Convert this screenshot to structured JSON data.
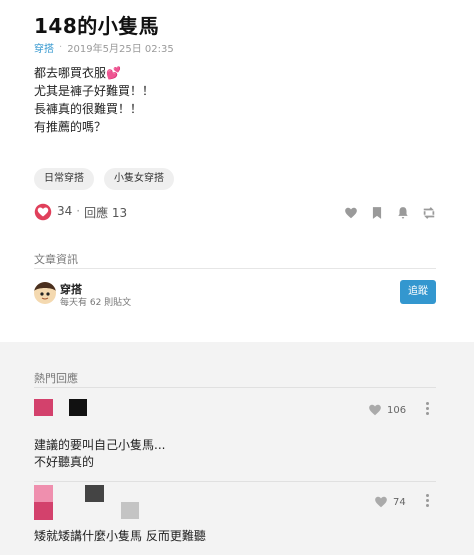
{
  "post": {
    "title": "148的小隻馬",
    "forum": "穿搭",
    "time": "2019年5月25日 02:35",
    "lines": [
      "都去哪買衣服💕",
      "尤其是褲子好難買！！",
      "長褲真的很難買！！",
      "有推薦的嗎？"
    ],
    "tags": [
      "日常穿搭",
      "小隻女穿搭"
    ],
    "likes": "34",
    "replies": "回應 13",
    "separator": "·"
  },
  "colors": {
    "accent": "#3397cf",
    "like_red": "#e0405b"
  },
  "board_info": {
    "section_label": "文章資訊",
    "name": "穿搭",
    "sub": "每天有 62 則貼文",
    "follow_label": "追蹤"
  },
  "hot_comments": {
    "label": "熱門回應",
    "items": [
      {
        "text_lines": [
          "建議的要叫自己小隻馬...",
          "不好聽真的"
        ],
        "likes": "106"
      },
      {
        "text_lines": [
          "矮就矮講什麼小隻馬 反而更難聽"
        ],
        "likes": "74"
      }
    ]
  }
}
